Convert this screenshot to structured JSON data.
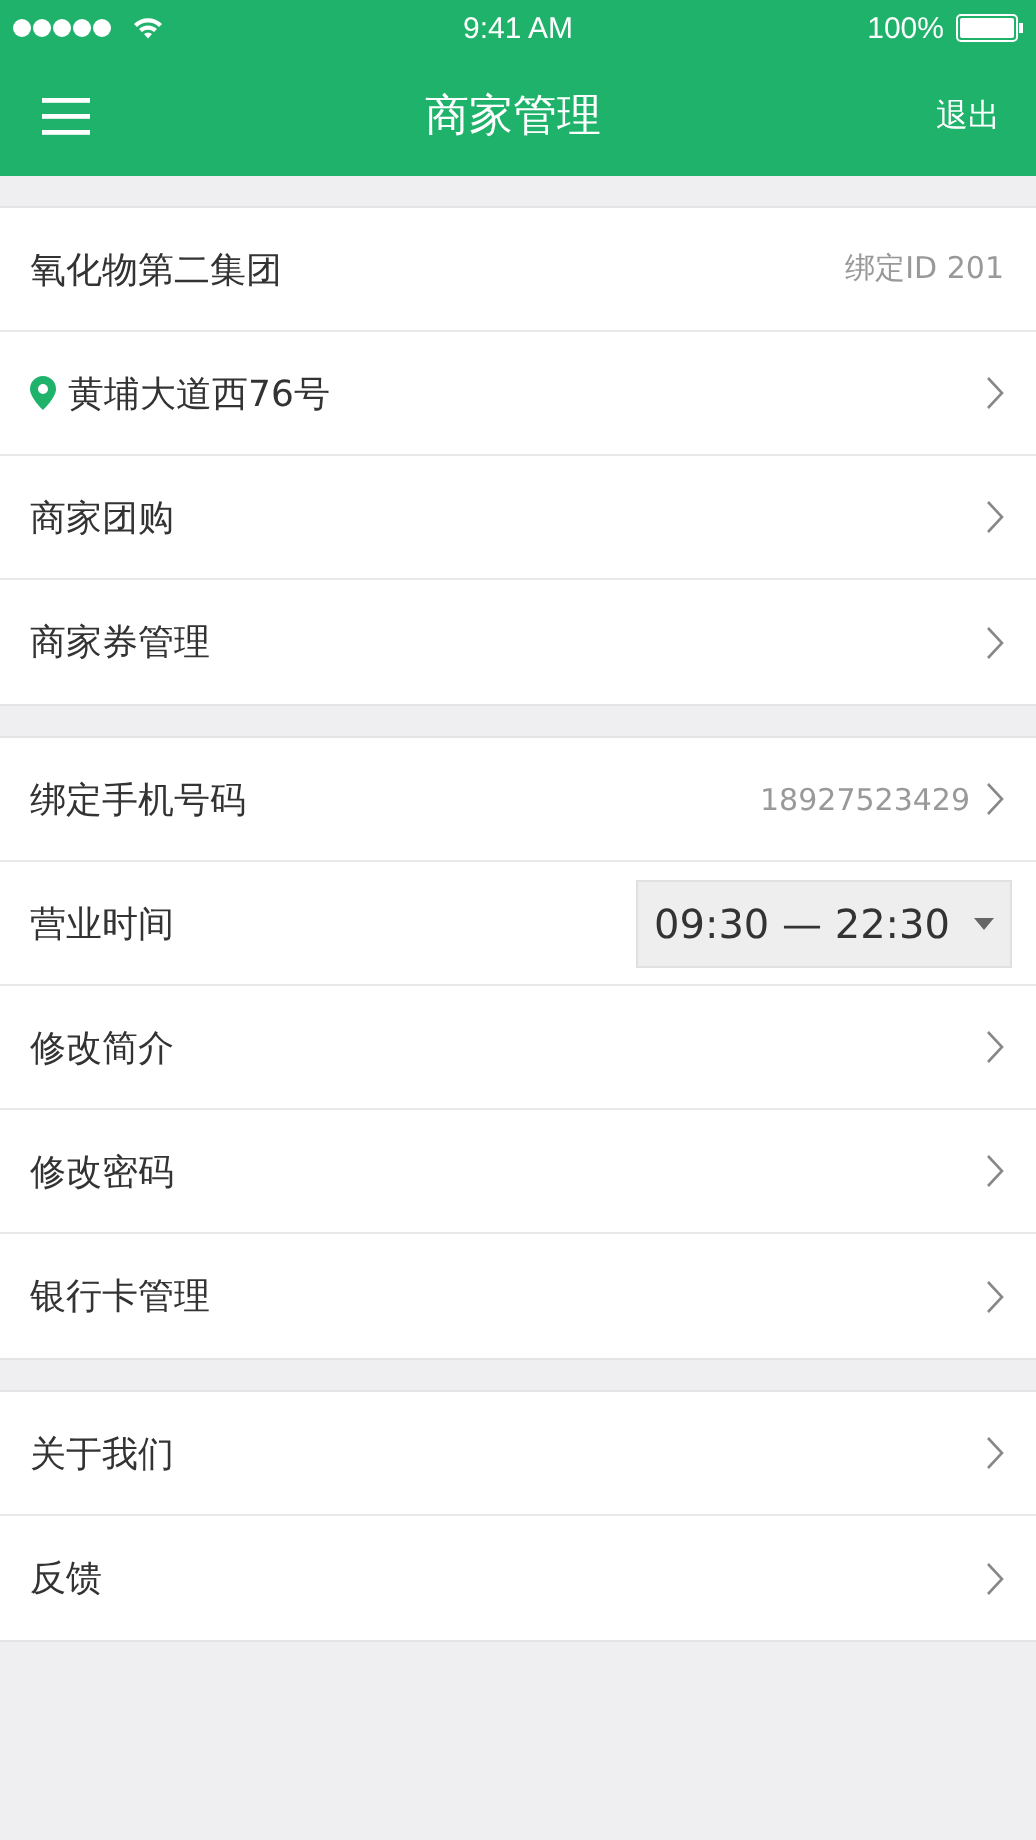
{
  "status_bar": {
    "time": "9:41 AM",
    "battery": "100%"
  },
  "nav": {
    "title": "商家管理",
    "action": "退出"
  },
  "sections": [
    {
      "rows": [
        {
          "kind": "info",
          "label": "氧化物第二集团",
          "value": "绑定ID 201"
        },
        {
          "kind": "location",
          "label": "黄埔大道西76号"
        },
        {
          "kind": "link",
          "label": "商家团购"
        },
        {
          "kind": "link",
          "label": "商家券管理"
        }
      ]
    },
    {
      "rows": [
        {
          "kind": "link",
          "label": "绑定手机号码",
          "value": "18927523429"
        },
        {
          "kind": "time",
          "label": "营业时间",
          "value": "09:30 — 22:30"
        },
        {
          "kind": "link",
          "label": "修改简介"
        },
        {
          "kind": "link",
          "label": "修改密码"
        },
        {
          "kind": "link",
          "label": "银行卡管理"
        }
      ]
    },
    {
      "rows": [
        {
          "kind": "link",
          "label": "关于我们"
        },
        {
          "kind": "link",
          "label": "反馈"
        }
      ]
    }
  ]
}
